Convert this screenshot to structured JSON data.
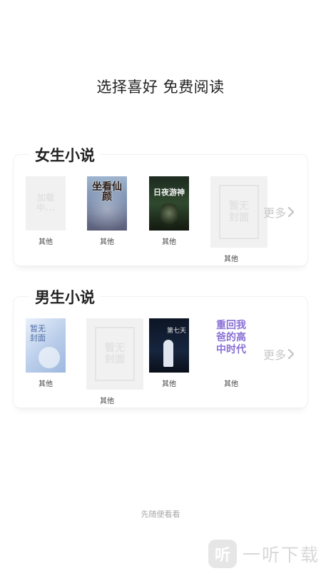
{
  "page_title": "选择喜好 免费阅读",
  "sections": [
    {
      "title": "女生小说",
      "more": "更多",
      "books": [
        {
          "label": "其他",
          "cover_text": "加载\n中..."
        },
        {
          "label": "其他",
          "cover_text": "坐看仙颜"
        },
        {
          "label": "其他",
          "cover_text": "日夜游神"
        },
        {
          "label": "其他",
          "cover_text": "暂无\n封面"
        }
      ]
    },
    {
      "title": "男生小说",
      "more": "更多",
      "books": [
        {
          "label": "其他",
          "cover_text": "暂无\n封面"
        },
        {
          "label": "其他",
          "cover_text": "暂无\n封面"
        },
        {
          "label": "其他",
          "cover_text": "第七天"
        },
        {
          "label": "其他",
          "cover_text": "重回我爸的高中时代"
        }
      ]
    }
  ],
  "footer_link": "先随便看看",
  "watermark": {
    "logo": "听",
    "text": "一听下载"
  },
  "colors": {
    "muted": "#c8c8c8",
    "placeholder_bg": "#f1f1f1",
    "border": "#f0f0f0"
  }
}
